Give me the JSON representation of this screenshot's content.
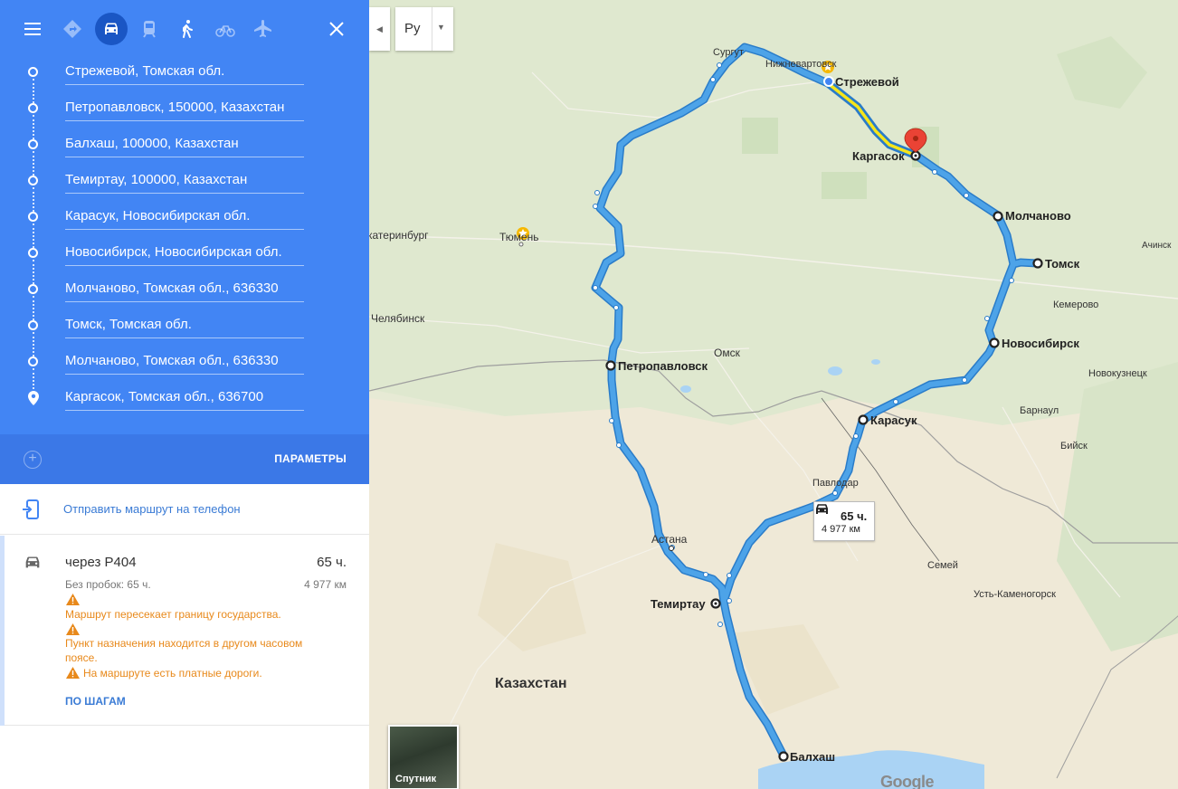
{
  "toolbar": {
    "modes": [
      "menu-icon",
      "best-route-icon",
      "car-icon",
      "transit-icon",
      "walk-icon",
      "bike-icon",
      "flight-icon",
      "close-icon"
    ],
    "active_mode": "car"
  },
  "waypoints": [
    {
      "label": "Стрежевой, Томская обл."
    },
    {
      "label": "Петропавловск, 150000, Казахстан"
    },
    {
      "label": "Балхаш, 100000, Казахстан"
    },
    {
      "label": "Темиртау, 100000, Казахстан"
    },
    {
      "label": "Карасук, Новосибирская обл."
    },
    {
      "label": "Новосибирск, Новосибирская обл."
    },
    {
      "label": "Молчаново, Томская обл., 636330"
    },
    {
      "label": "Томск, Томская обл."
    },
    {
      "label": "Молчаново, Томская обл., 636330"
    },
    {
      "label": "Каргасок, Томская обл., 636700"
    }
  ],
  "params_label": "ПАРАМЕТРЫ",
  "send_to_phone": "Отправить маршрут на телефон",
  "route": {
    "via": "через Р404",
    "duration": "65 ч.",
    "no_traffic": "Без пробок: 65 ч.",
    "distance": "4 977 км",
    "warnings": [
      "Маршрут пересекает границу государства.",
      "Пункт назначения находится в другом часовом поясе.",
      "На маршруте есть платные дороги."
    ],
    "steps_link": "ПО ШАГАМ"
  },
  "map": {
    "lang_button": "Ру",
    "info_duration": "65 ч.",
    "info_distance": "4 977 км",
    "satellite_label": "Спутник",
    "google_logo": "Google",
    "colors": {
      "route": "#4da3e8",
      "route_border": "#2a7cc9",
      "highlight": "#f5e51b",
      "pin": "#ea4335"
    },
    "labels": {
      "strezhevoy": "Стрежевой",
      "kargasok": "Каргасок",
      "molchanovo": "Молчаново",
      "tomsk": "Томск",
      "novosibirsk": "Новосибирск",
      "karasuk": "Карасук",
      "petropavlovsk": "Петропавловск",
      "temirtau": "Темиртау",
      "balkhash": "Балхаш",
      "kazakhstan": "Казахстан",
      "surgut": "Сургут",
      "nizhnevartovsk": "Нижневартовск",
      "tyumen": "Тюмень",
      "yekaterinburg": "Екатеринбург",
      "chelyabinsk": "Челябинск",
      "omsk": "Омск",
      "astana": "Астана",
      "pavlodar": "Павлодар",
      "semey": "Семей",
      "ust_kamenogorsk": "Усть-Каменогорск",
      "barnaul": "Барнаул",
      "biysk": "Бийск",
      "novokuznetsk": "Новокузнецк",
      "kemerovo": "Кемерово",
      "achinsk": "Ачинск"
    }
  }
}
